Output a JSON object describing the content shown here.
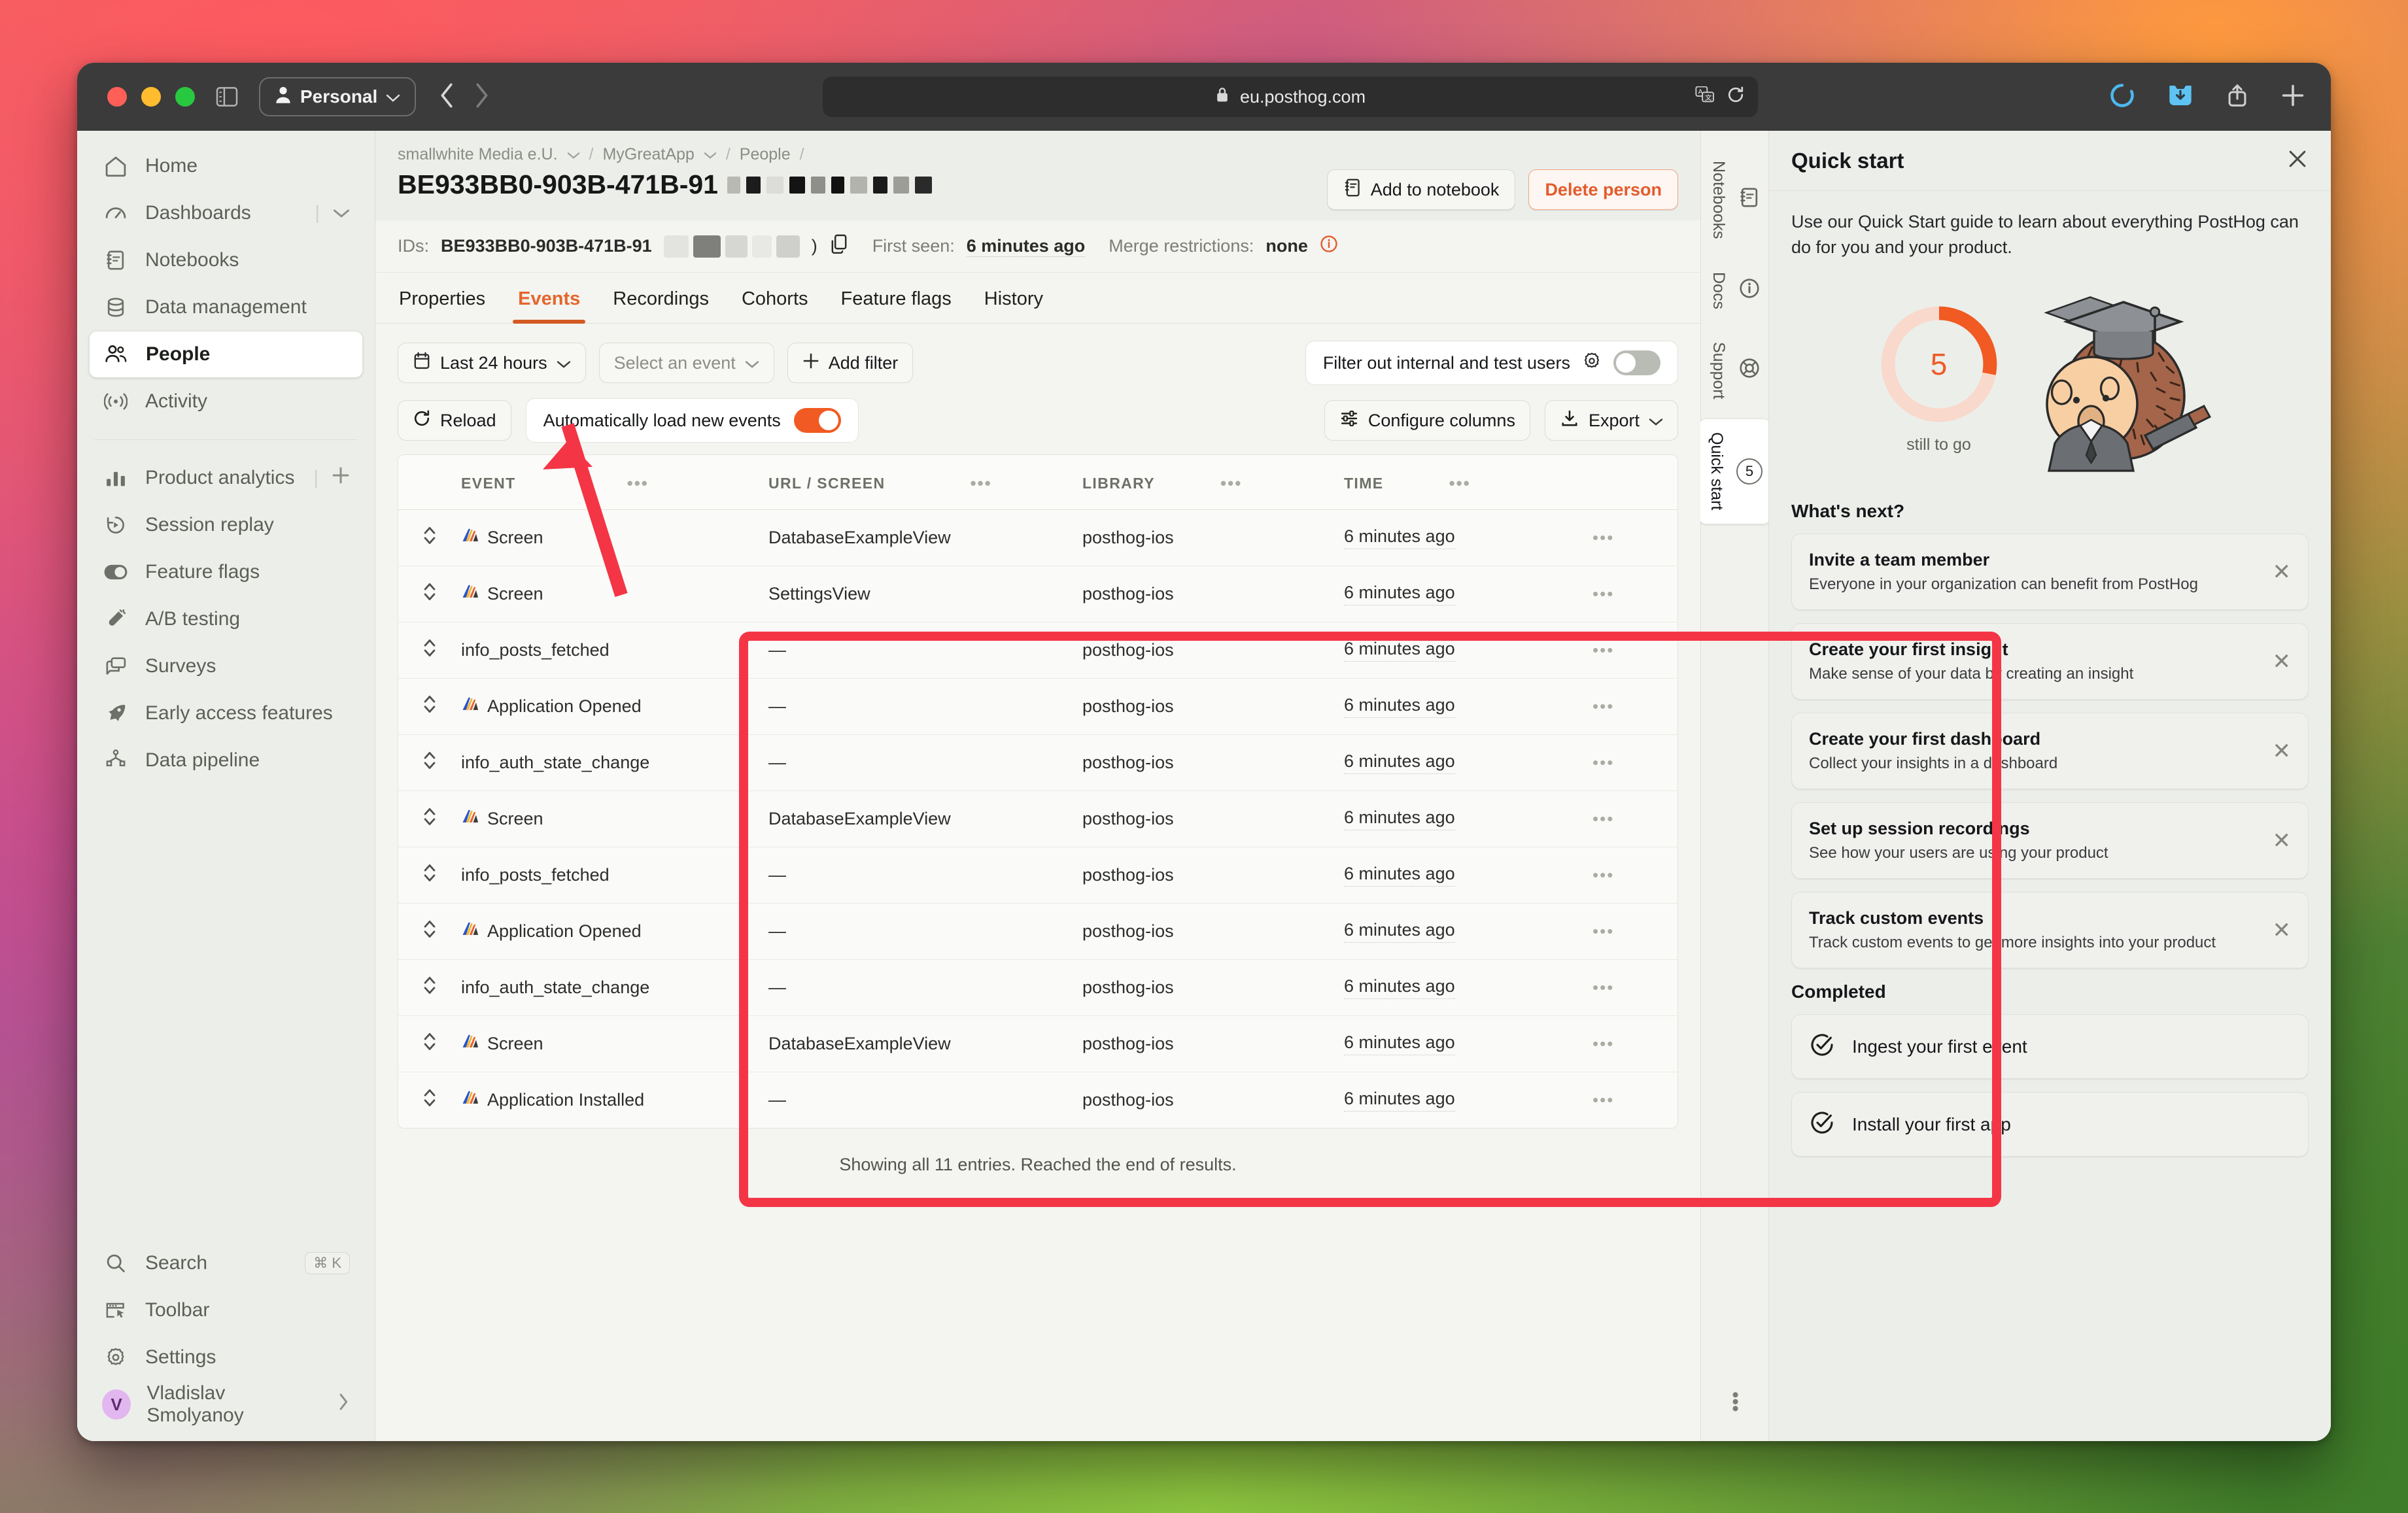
{
  "browser": {
    "profile_label": "Personal",
    "url": "eu.posthog.com",
    "lock_icon": "lock-icon",
    "back_icon": "chevron-left-icon",
    "forward_icon": "chevron-right-icon",
    "sidebar_toggle_icon": "sidebar-toggle-icon",
    "translate_icon": "translate-icon",
    "reload_icon": "reload-icon",
    "loading_icon": "loading-spinner-icon",
    "download_icon": "download-icon",
    "share_icon": "share-icon",
    "newtab_icon": "plus-icon"
  },
  "sidebar": {
    "primary": [
      {
        "label": "Home",
        "icon": "home-icon"
      },
      {
        "label": "Dashboards",
        "icon": "gauge-icon",
        "trailing": "chevron-down-icon"
      },
      {
        "label": "Notebooks",
        "icon": "notebook-icon"
      },
      {
        "label": "Data management",
        "icon": "database-icon"
      },
      {
        "label": "People",
        "icon": "people-icon",
        "active": true
      },
      {
        "label": "Activity",
        "icon": "activity-icon"
      }
    ],
    "secondary": [
      {
        "label": "Product analytics",
        "icon": "bar-chart-icon",
        "trailing": "plus-icon"
      },
      {
        "label": "Session replay",
        "icon": "replay-icon"
      },
      {
        "label": "Feature flags",
        "icon": "toggle-icon"
      },
      {
        "label": "A/B testing",
        "icon": "flask-icon"
      },
      {
        "label": "Surveys",
        "icon": "chat-icon"
      },
      {
        "label": "Early access features",
        "icon": "rocket-icon"
      },
      {
        "label": "Data pipeline",
        "icon": "pipeline-icon"
      }
    ],
    "bottom": [
      {
        "label": "Search",
        "icon": "search-icon",
        "shortcut": "⌘ K"
      },
      {
        "label": "Toolbar",
        "icon": "toolbar-icon"
      },
      {
        "label": "Settings",
        "icon": "gear-icon"
      }
    ],
    "user": {
      "name": "Vladislav Smolyanoy",
      "initial": "V",
      "chevron": "chevron-right-icon"
    }
  },
  "header": {
    "breadcrumbs": [
      "smallwhite Media e.U.",
      "MyGreatApp",
      "People"
    ],
    "person_id_visible": "BE933BB0-903B-471B-91",
    "ids_label": "IDs:",
    "ids_value": "BE933BB0-903B-471B-91",
    "copy_icon": "copy-icon",
    "first_seen_label": "First seen:",
    "first_seen_value": "6 minutes ago",
    "merge_label": "Merge restrictions:",
    "merge_value": "none",
    "info_icon": "info-icon",
    "add_to_notebook": "Add to notebook",
    "notebook_icon": "notebook-icon",
    "delete_person": "Delete person"
  },
  "tabs": [
    {
      "label": "Properties"
    },
    {
      "label": "Events",
      "active": true
    },
    {
      "label": "Recordings"
    },
    {
      "label": "Cohorts"
    },
    {
      "label": "Feature flags"
    },
    {
      "label": "History"
    }
  ],
  "filters": {
    "date_range": "Last 24 hours",
    "calendar_icon": "calendar-icon",
    "select_event_placeholder": "Select an event",
    "add_filter": "Add filter",
    "internal_users_label": "Filter out internal and test users",
    "internal_users_gear": "gear-icon",
    "internal_users_on": false
  },
  "toolbar": {
    "reload": "Reload",
    "reload_icon": "reload-icon",
    "auto_load_label": "Automatically load new events",
    "auto_load_on": true,
    "configure_columns": "Configure columns",
    "configure_icon": "sliders-icon",
    "export": "Export",
    "export_icon": "download-icon",
    "export_chevron": "chevron-down-icon"
  },
  "table": {
    "columns": [
      "EVENT",
      "URL / SCREEN",
      "LIBRARY",
      "TIME"
    ],
    "column_menu_icon": "ellipsis-icon",
    "row_expand_icon": "expand-rows-icon",
    "row_menu_icon": "ellipsis-icon",
    "screen_event_icon": "posthog-comet-icon",
    "rows": [
      {
        "icon": true,
        "event": "Screen",
        "url": "DatabaseExampleView",
        "library": "posthog-ios",
        "time": "6 minutes ago"
      },
      {
        "icon": true,
        "event": "Screen",
        "url": "SettingsView",
        "library": "posthog-ios",
        "time": "6 minutes ago"
      },
      {
        "icon": false,
        "event": "info_posts_fetched",
        "url": "—",
        "library": "posthog-ios",
        "time": "6 minutes ago"
      },
      {
        "icon": true,
        "event": "Application Opened",
        "url": "—",
        "library": "posthog-ios",
        "time": "6 minutes ago"
      },
      {
        "icon": false,
        "event": "info_auth_state_change",
        "url": "—",
        "library": "posthog-ios",
        "time": "6 minutes ago"
      },
      {
        "icon": true,
        "event": "Screen",
        "url": "DatabaseExampleView",
        "library": "posthog-ios",
        "time": "6 minutes ago"
      },
      {
        "icon": false,
        "event": "info_posts_fetched",
        "url": "—",
        "library": "posthog-ios",
        "time": "6 minutes ago"
      },
      {
        "icon": true,
        "event": "Application Opened",
        "url": "—",
        "library": "posthog-ios",
        "time": "6 minutes ago"
      },
      {
        "icon": false,
        "event": "info_auth_state_change",
        "url": "—",
        "library": "posthog-ios",
        "time": "6 minutes ago"
      },
      {
        "icon": true,
        "event": "Screen",
        "url": "DatabaseExampleView",
        "library": "posthog-ios",
        "time": "6 minutes ago"
      },
      {
        "icon": true,
        "event": "Application Installed",
        "url": "—",
        "library": "posthog-ios",
        "time": "6 minutes ago"
      }
    ],
    "footer": "Showing all 11 entries. Reached the end of results."
  },
  "rail": [
    {
      "label": "Notebooks",
      "icon": "notebook-icon"
    },
    {
      "label": "Docs",
      "icon": "info-icon"
    },
    {
      "label": "Support",
      "icon": "lifebuoy-icon"
    },
    {
      "label": "Quick start",
      "icon": "badge-count",
      "badge": "5",
      "active": true
    }
  ],
  "rail_overflow_icon": "ellipsis-vertical-icon",
  "quick_start": {
    "title": "Quick start",
    "close_icon": "close-icon",
    "description": "Use our Quick Start guide to learn about everything PostHog can do for you and your product.",
    "progress_number": "5",
    "progress_caption": "still to go",
    "progress_percent": 28,
    "hedgehog_icon": "graduate-hedgehog-illustration",
    "next_heading": "What's next?",
    "next_items": [
      {
        "title": "Invite a team member",
        "subtitle": "Everyone in your organization can benefit from PostHog"
      },
      {
        "title": "Create your first insight",
        "subtitle": "Make sense of your data by creating an insight"
      },
      {
        "title": "Create your first dashboard",
        "subtitle": "Collect your insights in a dashboard"
      },
      {
        "title": "Set up session recordings",
        "subtitle": "See how your users are using your product"
      },
      {
        "title": "Track custom events",
        "subtitle": "Track custom events to get more insights into your product"
      }
    ],
    "completed_heading": "Completed",
    "completed_items": [
      {
        "title": "Ingest your first event",
        "icon": "check-circle-icon"
      },
      {
        "title": "Install your first app",
        "icon": "check-circle-icon"
      }
    ]
  },
  "colors": {
    "accent_orange": "#f15a22",
    "tab_active": "#e5662b",
    "annotation_red": "#f43545",
    "danger": "#e35c2c"
  }
}
